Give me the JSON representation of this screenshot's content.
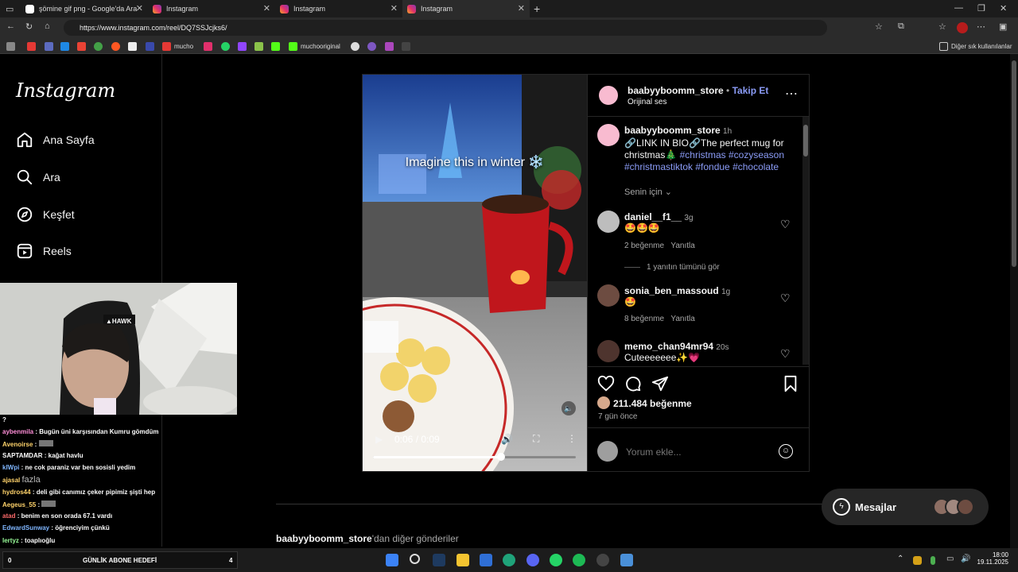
{
  "browser": {
    "tabs": [
      {
        "title": "şömine gif png - Google'da Ara",
        "active": false
      },
      {
        "title": "Instagram",
        "active": false
      },
      {
        "title": "Instagram",
        "active": false
      },
      {
        "title": "Instagram",
        "active": true
      }
    ],
    "url": "https://www.instagram.com/reel/DQ7SSJcjks6/",
    "bookmarks": [
      "mucho",
      "muchooriginal"
    ],
    "other_bookmarks": "Diğer sık kullanılanlar"
  },
  "sidebar": {
    "logo": "Instagram",
    "items": [
      {
        "label": "Ana Sayfa",
        "icon": "home-icon"
      },
      {
        "label": "Ara",
        "icon": "search-icon"
      },
      {
        "label": "Keşfet",
        "icon": "compass-icon"
      },
      {
        "label": "Reels",
        "icon": "reels-icon"
      }
    ]
  },
  "post": {
    "username": "baabyyboomm_store",
    "follow": "Takip Et",
    "separator": "•",
    "audio": "Orijinal ses",
    "video_caption": "Imagine this in winter ❄️",
    "time_display": "0:06 / 0:09",
    "progress": 0.63,
    "caption": {
      "user": "baabyyboomm_store",
      "time": "1h",
      "text": "🔗LINK IN BIO🔗The perfect mug for christmas🎄",
      "hashtags": "#christmas #cozyseason #christmastiktok #fondue #chocolate"
    },
    "translation_note": "Senin için",
    "comments": [
      {
        "user": "daniel__f1__",
        "time": "3g",
        "text": "🤩🤩🤩",
        "likes": "2 beğenme",
        "reply": "Yanıtla",
        "view_replies": "1 yanıtın tümünü gör"
      },
      {
        "user": "sonia_ben_massoud",
        "time": "1g",
        "text": "🤩",
        "likes": "8 beğenme",
        "reply": "Yanıtla"
      },
      {
        "user": "memo_chan94mr94",
        "time": "20s",
        "text": "Cuteeeeeee✨💗"
      }
    ],
    "likes": "211.484 beğenme",
    "date": "7 gün önce",
    "add_comment_placeholder": "Yorum ekle..."
  },
  "more_posts_heading": {
    "user": "baabyyboomm_store",
    "suffix": "'dan diğer gönderiler"
  },
  "messages": {
    "label": "Mesajlar"
  },
  "stream": {
    "chat": [
      {
        "user": "?",
        "text": "",
        "color": "#ffffff"
      },
      {
        "user": "aybenmila",
        "text": ": Bugün üni karşısından Kumru gömdüm",
        "color": "#ff8fd8"
      },
      {
        "user": "Avenoirse",
        "text": ":",
        "color": "#ffd36b"
      },
      {
        "user": "SAPTAMDAR",
        "text": ": kağat havlu",
        "color": "#ffffff"
      },
      {
        "user": "klWpi",
        "text": ": ne cok paraniz var ben sosisli yedim",
        "color": "#7fb6ff"
      },
      {
        "user": "ajasal",
        "text": "",
        "color": "#ffd36b"
      },
      {
        "user": "hydros44",
        "text": ": deli gibi canımız çeker pipimiz şişti hep",
        "color": "#ffd36b"
      },
      {
        "user": "Aegeus_55",
        "text": ":",
        "color": "#ffd36b"
      },
      {
        "user": "atad",
        "text": ": benim en son oradа 67.1 vardı",
        "color": "#ff6b6b"
      },
      {
        "user": "EdwardSunway",
        "text": ": öğrenciyim çünkü",
        "color": "#7fb6ff"
      },
      {
        "user": "lertyz",
        "text": ": toaplıoğlu",
        "color": "#9bff9b"
      }
    ],
    "overlay_more": "fazla",
    "goal_label": "GÜNLİK ABONE HEDEFİ",
    "goal_left": "0",
    "goal_right": "4"
  },
  "taskbar": {
    "time": "18:00",
    "date": "19.11.2025"
  },
  "colors": {
    "accent": "#8b9cf7",
    "follow": "#8b9cf7",
    "bg": "#000000"
  }
}
